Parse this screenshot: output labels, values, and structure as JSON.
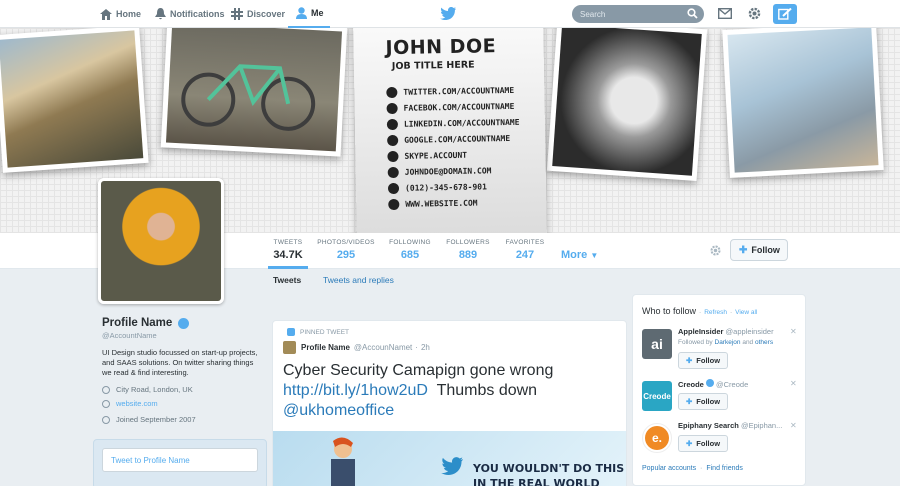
{
  "nav": {
    "items": [
      {
        "label": "Home",
        "icon": "home-icon"
      },
      {
        "label": "Notifications",
        "icon": "bell-icon"
      },
      {
        "label": "Discover",
        "icon": "hash-icon"
      },
      {
        "label": "Me",
        "icon": "person-icon"
      }
    ],
    "search_placeholder": "Search",
    "accent": "#55acee"
  },
  "header": {
    "card": {
      "name": "JOHN DOE",
      "title": "JOB TITLE HERE",
      "rows": [
        "TWITTER.COM/ACCOUNTNAME",
        "FACEBOK.COM/ACCOUNTNAME",
        "LINKEDIN.COM/ACCOUNTNAME",
        "GOOGLE.COM/ACCOUNTNAME",
        "SKYPE.ACCOUNT",
        "JOHNDOE@DOMAIN.COM",
        "(012)-345-678-901",
        "WWW.WEBSITE.COM"
      ]
    }
  },
  "stats": [
    {
      "label": "TWEETS",
      "value": "34.7K"
    },
    {
      "label": "PHOTOS/VIDEOS",
      "value": "295"
    },
    {
      "label": "FOLLOWING",
      "value": "685"
    },
    {
      "label": "FOLLOWERS",
      "value": "889"
    },
    {
      "label": "FAVORITES",
      "value": "247"
    }
  ],
  "more_label": "More",
  "follow_label": "Follow",
  "profile": {
    "name": "Profile Name",
    "handle": "@AccountName",
    "bio": "UI Design studio focussed on start-up projects, and SAAS solutions. On twitter sharing things we read & find interesting.",
    "location": "City Road, London, UK",
    "website": "website.com",
    "joined": "Joined September 2007",
    "tweet_to": "Tweet to Profile Name"
  },
  "tabs": [
    "Tweets",
    "Tweets and replies"
  ],
  "tweet": {
    "pinned": "PINNED TWEET",
    "name": "Profile Name",
    "handle": "@AccounNamet",
    "time": "2h",
    "text_a": "Cyber Security Camapign gone wrong",
    "link": "http://bit.ly/1how2uD",
    "text_b": "Thumbs down",
    "mention": "@ukhomeoffice",
    "media_headline_1": "YOU WOULDN'T DO THIS",
    "media_headline_2": "IN THE REAL WORLD"
  },
  "who_to_follow": {
    "title": "Who to follow",
    "refresh": "Refresh",
    "view_all": "View all",
    "suggestions": [
      {
        "name": "AppleInsider",
        "handle": "@appleinsider",
        "sub_prefix": "Followed by",
        "sub_a": "Darkejon",
        "sub_mid": "and",
        "sub_b": "others",
        "logo": "ai",
        "color": "#5e6a72"
      },
      {
        "name": "Creode",
        "handle": "@Creode",
        "logo": "Creode",
        "color": "#2aa6c4"
      },
      {
        "name": "Epiphany Search",
        "handle": "@Epiphan...",
        "logo": "e.",
        "color": "#f08a24"
      }
    ],
    "popular": "Popular accounts",
    "find": "Find friends"
  }
}
